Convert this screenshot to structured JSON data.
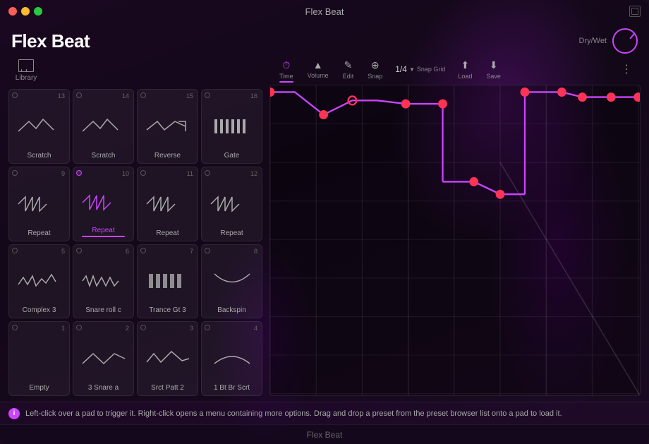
{
  "window": {
    "title": "Flex Beat",
    "footer_label": "Flex Beat"
  },
  "header": {
    "title": "Flex Beat",
    "dry_wet_label": "Dry/Wet"
  },
  "library": {
    "label": "Library"
  },
  "toolbar": {
    "time_label": "Time",
    "volume_label": "Volume",
    "edit_label": "Edit",
    "snap_label": "Snap",
    "snap_grid_label": "Snap Grid",
    "snap_grid_value": "1/4",
    "load_label": "Load",
    "save_label": "Save"
  },
  "pads": [
    {
      "id": 1,
      "num": "1",
      "label": "Empty",
      "active": false,
      "waveform": "empty",
      "highlight": false
    },
    {
      "id": 2,
      "num": "2",
      "label": "3 Snare a",
      "active": false,
      "waveform": "snare",
      "highlight": false
    },
    {
      "id": 3,
      "num": "3",
      "label": "Srct Patt 2",
      "active": false,
      "waveform": "scratch2",
      "highlight": false
    },
    {
      "id": 4,
      "num": "4",
      "label": "1 Bt Br Scrt",
      "active": false,
      "waveform": "backspin2",
      "highlight": false
    },
    {
      "id": 5,
      "num": "5",
      "label": "Complex 3",
      "active": false,
      "waveform": "complex",
      "highlight": false
    },
    {
      "id": 6,
      "num": "6",
      "label": "Snare roll c",
      "active": false,
      "waveform": "snareroll",
      "highlight": false
    },
    {
      "id": 7,
      "num": "7",
      "label": "Trance Gt 3",
      "active": false,
      "waveform": "gate2",
      "highlight": false
    },
    {
      "id": 8,
      "num": "8",
      "label": "Backspin",
      "active": false,
      "waveform": "backspin",
      "highlight": false
    },
    {
      "id": 9,
      "num": "9",
      "label": "Repeat",
      "active": false,
      "waveform": "repeat",
      "highlight": false
    },
    {
      "id": 10,
      "num": "10",
      "label": "Repeat",
      "active": true,
      "waveform": "repeat2",
      "highlight": true
    },
    {
      "id": 11,
      "num": "11",
      "label": "Repeat",
      "active": false,
      "waveform": "repeat",
      "highlight": false
    },
    {
      "id": 12,
      "num": "12",
      "label": "Repeat",
      "active": false,
      "waveform": "repeat",
      "highlight": false
    },
    {
      "id": 13,
      "num": "13",
      "label": "Scratch",
      "active": false,
      "waveform": "scratch",
      "highlight": false
    },
    {
      "id": 14,
      "num": "14",
      "label": "Scratch",
      "active": false,
      "waveform": "scratch",
      "highlight": false
    },
    {
      "id": 15,
      "num": "15",
      "label": "Reverse",
      "active": false,
      "waveform": "reverse",
      "highlight": false
    },
    {
      "id": 16,
      "num": "16",
      "label": "Gate",
      "active": false,
      "waveform": "gate",
      "highlight": false
    }
  ],
  "info": {
    "text": "Left-click over a pad to trigger it. Right-click opens a menu containing more options. Drag and drop a preset from the preset browser list onto a pad to load it."
  }
}
